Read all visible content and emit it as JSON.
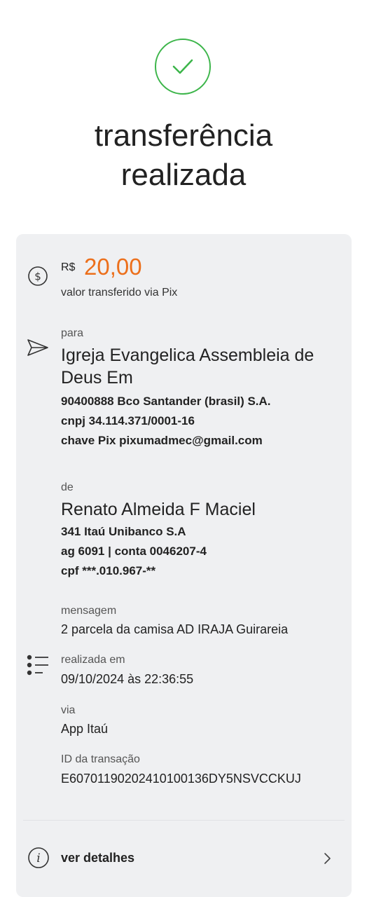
{
  "header": {
    "title_line1": "transferência",
    "title_line2": "realizada",
    "success_icon": "check-circle-icon",
    "success_color": "#3cb54a"
  },
  "amount": {
    "currency": "R$",
    "value": "20,00",
    "label": "valor transferido via Pix",
    "icon": "dollar-circle-icon",
    "color": "#ec6f1b"
  },
  "recipient": {
    "label": "para",
    "name": "Igreja Evangelica Assembleia de Deus Em",
    "bank": "90400888 Bco Santander (brasil) S.A.",
    "cnpj": "cnpj 34.114.371/0001-16",
    "pix_key": "chave Pix pixumadmec@gmail.com",
    "icon": "send-icon"
  },
  "sender": {
    "label": "de",
    "name": "Renato Almeida F Maciel",
    "bank": "341 Itaú Unibanco S.A",
    "account": "ag 6091 | conta 0046207-4",
    "cpf": "cpf ***.010.967-**"
  },
  "info": {
    "icon": "list-icon",
    "message_label": "mensagem",
    "message": "2 parcela da camisa AD IRAJA Guirareia",
    "date_label": "realizada em",
    "date": "09/10/2024 às 22:36:55",
    "via_label": "via",
    "via": "App Itaú",
    "id_label": "ID da transação",
    "id": "E60701190202410100136DY5NSVCCKUJ"
  },
  "footer": {
    "details_label": "ver detalhes",
    "info_icon": "info-circle-icon",
    "chevron_icon": "chevron-right-icon"
  }
}
